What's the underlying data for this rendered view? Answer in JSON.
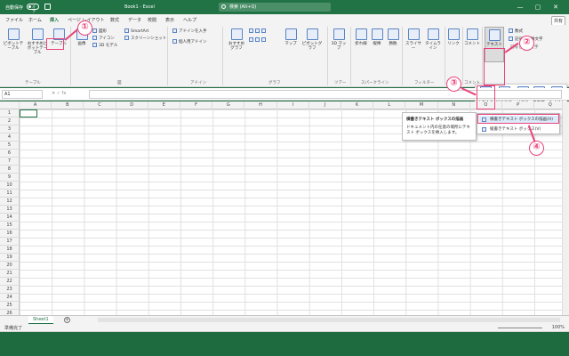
{
  "titlebar": {
    "autosave_label": "自動保存",
    "autosave_state": "オフ",
    "doc_title": "Book1 - Excel",
    "search_placeholder": "検索 (Alt+Q)",
    "minimize": "—",
    "restore": "▢",
    "close": "✕"
  },
  "ribbon_tabs": [
    "ファイル",
    "ホーム",
    "挿入",
    "ページ レイアウト",
    "数式",
    "データ",
    "校閲",
    "表示",
    "ヘルプ"
  ],
  "share_label": "共有",
  "ribbon": {
    "pivot_table": "ピボットテーブル",
    "recommended_pivot": "おすすめピボットテーブル",
    "table": "テーブル",
    "table_group": "テーブル",
    "images": "画像",
    "shapes": "図形",
    "icons": "アイコン",
    "models_3d": "3D モデル",
    "smartart": "SmartArt",
    "screenshot": "スクリーンショット",
    "illustrations_group": "図",
    "get_addins": "アドインを入手",
    "my_addins": "個人用アドイン",
    "addins_group": "アドイン",
    "recommended_charts": "おすすめグラフ",
    "maps": "マップ",
    "pivot_chart": "ピボットグラフ",
    "charts_group": "グラフ",
    "map_3d": "3D マップ",
    "tours_group": "ツアー",
    "line": "折れ線",
    "column": "縦棒",
    "win_loss": "勝敗",
    "sparklines_group": "スパークライン",
    "slicer": "スライサー",
    "timeline": "タイムライン",
    "filters_group": "フィルター",
    "link": "リンク",
    "links_group": "リンク",
    "comment": "コメント",
    "comments_group": "コメント",
    "text": "テキスト",
    "equation": "数式",
    "symbol": "記号と特殊文字",
    "symbols_group": "記号と特殊文字"
  },
  "text_menu": {
    "textbox": "テキスト ボックス",
    "header_footer": "ヘッダーと フッター",
    "wordart": "ワード アート",
    "signature_line": "署名欄",
    "object": "オブジェクト"
  },
  "tooltip": {
    "title": "横書きテキスト ボックスの描画",
    "body": "ドキュメント内の任意の場所にテキスト ボックスを挿入します。"
  },
  "dropdown": {
    "horizontal": "横書きテキスト ボックスの描画(H)",
    "vertical": "縦書きテキスト ボックス(V)"
  },
  "formula_bar": {
    "name_box": "A1",
    "fx": "✕  ✓  fx"
  },
  "grid": {
    "columns": [
      "A",
      "B",
      "C",
      "D",
      "E",
      "F",
      "G",
      "H",
      "I",
      "J",
      "K",
      "L",
      "M",
      "N",
      "O",
      "P",
      "Q",
      "R"
    ],
    "rows": [
      "1",
      "2",
      "3",
      "4",
      "5",
      "6",
      "7",
      "8",
      "9",
      "10",
      "11",
      "12",
      "13",
      "14",
      "15",
      "16",
      "17",
      "18",
      "19",
      "20",
      "21",
      "22",
      "23",
      "24",
      "25",
      "26"
    ]
  },
  "sheet_tab": "Sheet1",
  "add_sheet": "+",
  "status": {
    "text": "準備完了",
    "zoom": "100%"
  },
  "callouts": [
    "①",
    "②",
    "③",
    "④"
  ],
  "colors": {
    "brand": "#217346",
    "callout": "#e8437a"
  }
}
